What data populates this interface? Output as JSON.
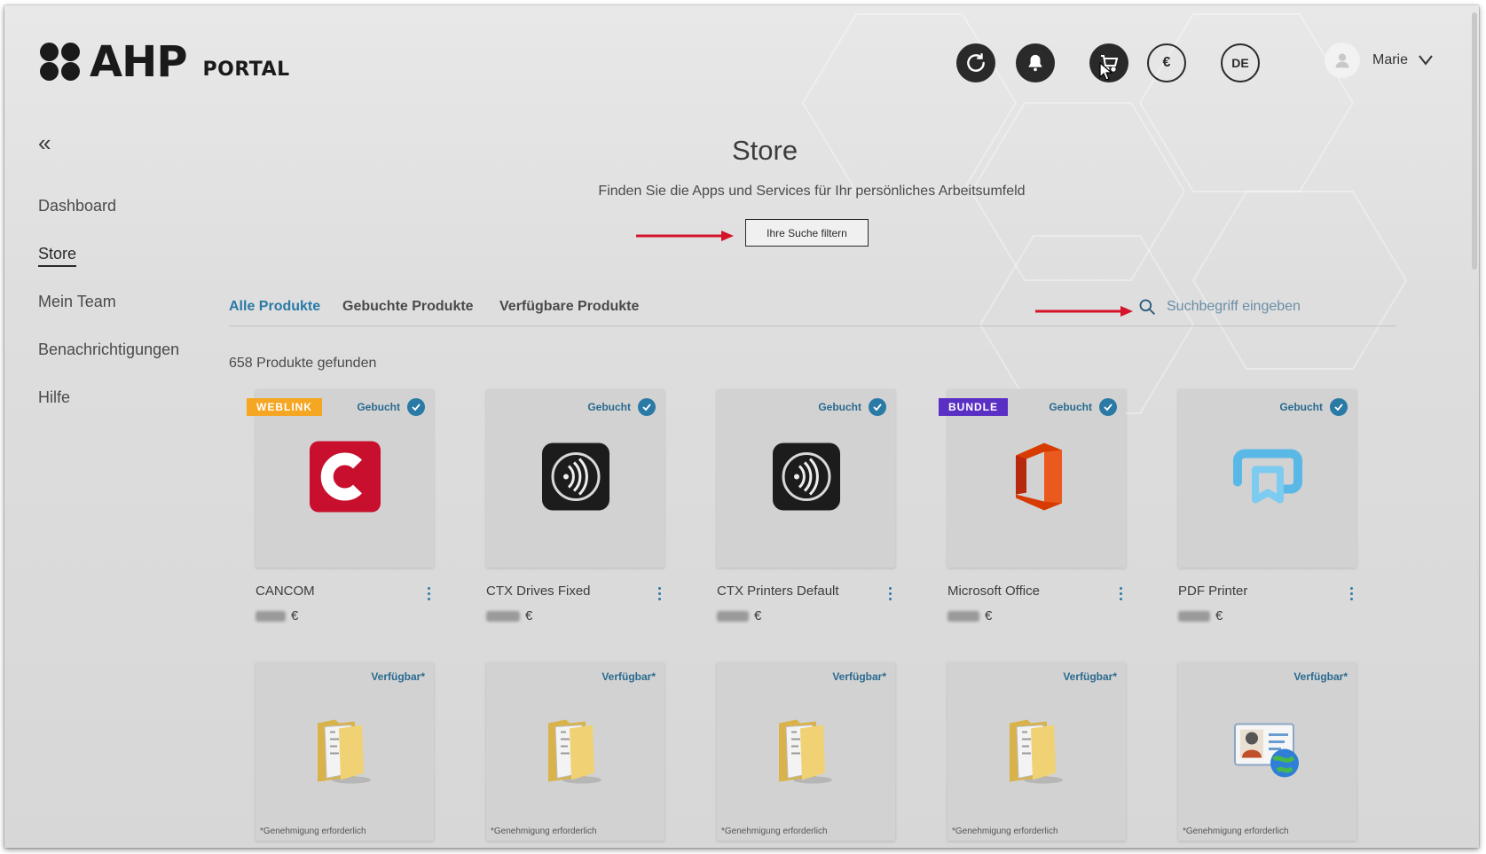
{
  "brand": {
    "logo_word": "AHP",
    "logo_sub": "PORTAL"
  },
  "header": {
    "currency_label": "€",
    "language_label": "DE",
    "user_name": "Marie"
  },
  "sidebar": {
    "items": [
      {
        "label": "Dashboard",
        "active": false
      },
      {
        "label": "Store",
        "active": true
      },
      {
        "label": "Mein Team",
        "active": false
      },
      {
        "label": "Benachrichtigungen",
        "active": false
      },
      {
        "label": "Hilfe",
        "active": false
      }
    ]
  },
  "main": {
    "title": "Store",
    "subtitle": "Finden Sie die Apps und Services für Ihr persönliches Arbeitsumfeld",
    "filter_button": "Ihre Suche filtern",
    "tabs": [
      {
        "label": "Alle Produkte",
        "active": true
      },
      {
        "label": "Gebuchte Produkte",
        "active": false
      },
      {
        "label": "Verfügbare Produkte",
        "active": false
      }
    ],
    "search_placeholder": "Suchbegriff eingeben",
    "result_count": "658 Produkte gefunden"
  },
  "colors": {
    "accent": "#2a7aa6",
    "weblink_badge": "#f5a623",
    "bundle_badge": "#5a2fc4"
  },
  "products_booked": [
    {
      "name": "CANCOM",
      "badge": "WEBLINK",
      "status": "Gebucht",
      "currency": "€",
      "icon": "cancom-logo-icon"
    },
    {
      "name": "CTX Drives Fixed",
      "badge": "",
      "status": "Gebucht",
      "currency": "€",
      "icon": "nfc-reader-icon"
    },
    {
      "name": "CTX Printers Default",
      "badge": "",
      "status": "Gebucht",
      "currency": "€",
      "icon": "nfc-reader-icon"
    },
    {
      "name": "Microsoft Office",
      "badge": "BUNDLE",
      "status": "Gebucht",
      "currency": "€",
      "icon": "microsoft-office-icon"
    },
    {
      "name": "PDF Printer",
      "badge": "",
      "status": "Gebucht",
      "currency": "€",
      "icon": "pdf-printer-icon"
    }
  ],
  "products_available": [
    {
      "status": "Verfügbar*",
      "note": "*Genehmigung erforderlich",
      "icon": "folder-icon"
    },
    {
      "status": "Verfügbar*",
      "note": "*Genehmigung erforderlich",
      "icon": "folder-icon"
    },
    {
      "status": "Verfügbar*",
      "note": "*Genehmigung erforderlich",
      "icon": "folder-icon"
    },
    {
      "status": "Verfügbar*",
      "note": "*Genehmigung erforderlich",
      "icon": "folder-icon"
    },
    {
      "status": "Verfügbar*",
      "note": "*Genehmigung erforderlich",
      "icon": "contact-card-globe-icon"
    }
  ]
}
